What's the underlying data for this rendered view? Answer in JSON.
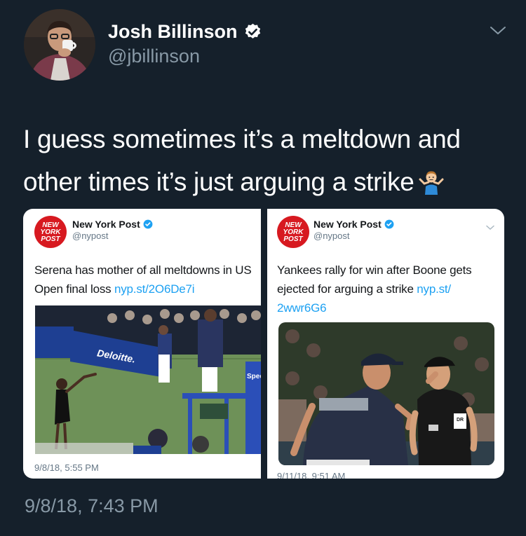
{
  "tweet": {
    "author_name": "Josh Billinson",
    "author_handle": "@jbillinson",
    "text": "I guess sometimes it’s a meltdown and other times it’s just arguing a strike",
    "emoji": "person-shrugging",
    "timestamp": "9/8/18, 7:43 PM"
  },
  "embeds": [
    {
      "account_name": "New York Post",
      "account_handle": "@nypost",
      "logo_text": [
        "NEW",
        "YORK",
        "POST"
      ],
      "text": "Serena has mother of all meltdowns in US Open final loss",
      "link": "nyp.st/2O6De7i",
      "photo_sign": "Deloitte.",
      "photo_chair_sign": "Spec",
      "date": "9/8/18, 5:55 PM"
    },
    {
      "account_name": "New York Post",
      "account_handle": "@nypost",
      "logo_text": [
        "NEW",
        "YORK",
        "POST"
      ],
      "text": "Yankees rally for win after Boone gets ejected for arguing a strike",
      "link_line1": "nyp.st/",
      "link_line2": "2wwr6G6",
      "photo_badge": "DR",
      "date": "9/11/18, 9:51 AM"
    }
  ],
  "colors": {
    "background": "#15202b",
    "link": "#1da1f2",
    "secondary": "#8899a6",
    "nyp_red": "#d71920"
  }
}
